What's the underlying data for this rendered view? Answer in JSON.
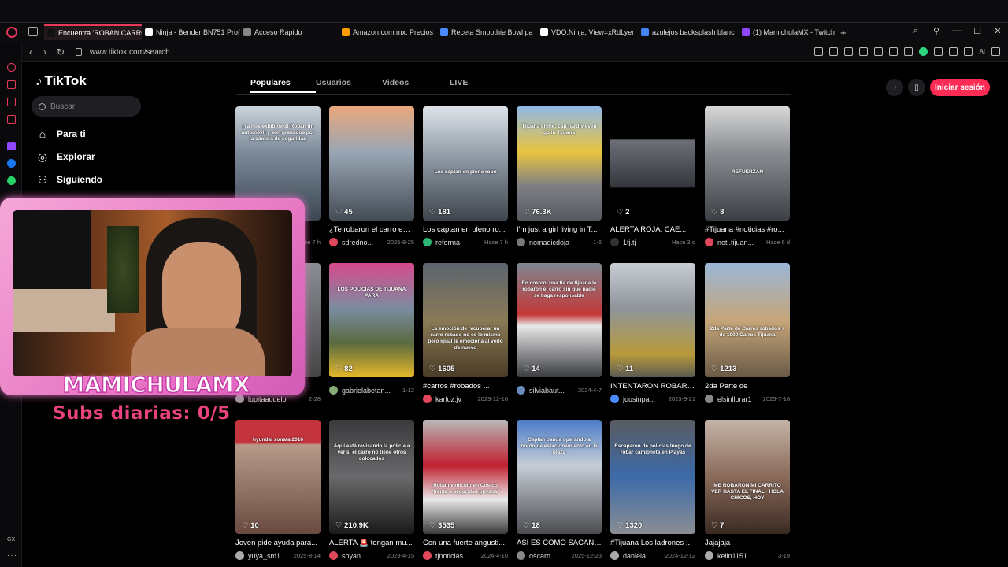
{
  "browser": {
    "tabs": [
      {
        "label": "Encuentra 'ROBAN CARRO",
        "color": "#111",
        "active": true
      },
      {
        "label": "Ninja - Bender BN751 Profe",
        "color": "#ffffff"
      },
      {
        "label": "Acceso Rápido",
        "color": "#888888"
      },
      {
        "label": "Amazon.com.mx: Precios",
        "color": "#ff9900"
      },
      {
        "label": "Receta Smoothie Bowl pa",
        "color": "#4a8cff"
      },
      {
        "label": "VDO.Ninja, View=xRdLyer",
        "color": "#ffffff"
      },
      {
        "label": "azulejos backsplash blanc",
        "color": "#4285f4"
      },
      {
        "label": "(1) MamichulaMX - Twitch",
        "color": "#9146ff"
      }
    ],
    "new_tab": "+",
    "url": "www.tiktok.com/search",
    "ai_label": "AI",
    "gx_label": "GX",
    "more_label": "···"
  },
  "tiktok": {
    "logo": "TikTok",
    "search_placeholder": "Buscar",
    "nav": [
      {
        "label": "Para ti",
        "icon": "home-icon"
      },
      {
        "label": "Explorar",
        "icon": "compass-icon"
      },
      {
        "label": "Siguiendo",
        "icon": "following-icon"
      }
    ],
    "tabs": [
      "Populares",
      "Usuarios",
      "Videos",
      "LIVE"
    ],
    "login": "Iniciar sesión",
    "videos": [
      {
        "likes": "",
        "caption": "...en",
        "user": "",
        "date": "Hace 7 h",
        "bg": "linear-gradient(#c9d3dc,#7d8a98 40%,#3a4652)",
        "av": "#888",
        "ovtxt": "¡Ya nos exhibimos! Roban un automóvil y son grabados por la cámara de seguridad"
      },
      {
        "likes": "45",
        "caption": "¿Te robaron el carro en ...",
        "user": "sdredno...",
        "date": "2025-8-25",
        "bg": "linear-gradient(#e8a77a,#9aa6b4 40%,#444c55)",
        "av": "#e0475b",
        "ovtxt": ""
      },
      {
        "likes": "181",
        "caption": "Los captan en pleno ro...",
        "user": "reforma",
        "date": "Hace 7 h",
        "bg": "linear-gradient(#dde3e8,#8f9aa5 45%,#3e454c)",
        "av": "#2bb673",
        "ovtxt": "Los captan en pleno robo"
      },
      {
        "likes": "76.3K",
        "caption": "I'm just a girl living in T...",
        "user": "nomadicdoja",
        "date": "1-6",
        "bg": "linear-gradient(#8fb8e8,#e9c43e 40%,#7d7f84 70%,#565a60)",
        "av": "#777",
        "ovtxt": "Tijuana crime: can hardly even go in Tijuana"
      },
      {
        "likes": "2",
        "caption": "ALERTA ROJA: CAE...",
        "user": "1tj.tj",
        "date": "Hace 3 d",
        "bg": "linear-gradient(#000 0%,#000 28%,#6c6f76 30%,#34373c 70%,#000 72%)",
        "av": "#333",
        "ovtxt": ""
      },
      {
        "likes": "8",
        "caption": "#Tijuana #noticias #ro...",
        "user": "noti.tijuan...",
        "date": "Hace 6 d",
        "bg": "linear-gradient(#d8d8d8,#8a8d92 40%,#3c3f44)",
        "av": "#e0475b",
        "ovtxt": "REFUERZAN"
      },
      {
        "likes": "",
        "caption": "...y si...",
        "user": "lupitaaudelo",
        "date": "2-28",
        "bg": "linear-gradient(#8a8e94,#444)",
        "av": "#999",
        "ovtxt": ""
      },
      {
        "likes": "82",
        "caption": "",
        "user": "gabrielabetan...",
        "date": "1-12",
        "bg": "linear-gradient(#d64a8c,#7a8ca0 40%,#5a6a40 70%,#e6b82a)",
        "av": "#8a7",
        "ovtxt": "LOS POLICIAS DE TIJUANA PARA"
      },
      {
        "likes": "1605",
        "caption": "#carros #robados ...",
        "user": "karloz.jv",
        "date": "2023-12-16",
        "bg": "linear-gradient(#5c6470,#8a7a56 50%,#4a3c26)",
        "av": "#e0475b",
        "ovtxt": "La emoción de recuperar un carro robado no es lo mismo pero igual te emociona al verlo de nuevo"
      },
      {
        "likes": "14",
        "caption": "",
        "user": "silviabaut...",
        "date": "2024-4-7",
        "bg": "linear-gradient(#7e8690,#c43838 45%,#e8e8e8 55%,#3a3c40)",
        "av": "#6a8cbb",
        "ovtxt": "En costco, una tía de tijuana le robaron el carro sin que nadie se haga responsable"
      },
      {
        "likes": "11",
        "caption": "INTENTARON ROBAR ...",
        "user": "jousinpa...",
        "date": "2023-9-21",
        "bg": "linear-gradient(#c8cdd2,#8e949a 40%,#b89a3a 80%,#5a5a52)",
        "av": "#4a8cff",
        "ovtxt": ""
      },
      {
        "likes": "1213",
        "caption": "2da Parte de",
        "user": "elsinllorar1",
        "date": "2025-7-16",
        "bg": "linear-gradient(#9ab6d6,#c6a67a 50%,#6a5a46)",
        "av": "#888",
        "ovtxt": "2da Parte de Carros robados + de 1000 Carros Tijuana"
      },
      {
        "likes": "10",
        "caption": "Joven pide ayuda para...",
        "user": "yuya_sm1",
        "date": "2025-8-14",
        "bg": "linear-gradient(#c4343c 0%,#c4343c 20%,#b89a8a 22%,#6a4a40)",
        "av": "#aaa",
        "ovtxt": "hyundai sonata 2016"
      },
      {
        "likes": "210.9K",
        "caption": "ALERTA 🚨 tengan mu...",
        "user": "soyan...",
        "date": "2023-4-15",
        "bg": "linear-gradient(#3a3a3c,#6a6a6c 50%,#1a1a1a)",
        "av": "#e0475b",
        "ovtxt": "Aquí está revisando la policía a ver si el carro no tiene otros colocados"
      },
      {
        "likes": "3535",
        "caption": "Con una fuerte angusti...",
        "user": "tjnoticias",
        "date": "2024-4-10",
        "bg": "linear-gradient(#b8b8b8,#c02030 40%,#e8e8e8 70%,#3a3a3a)",
        "av": "#e0475b",
        "ovtxt": "Roban vehículo en Costco \"frente a seguridad privada\""
      },
      {
        "likes": "18",
        "caption": "ASÍ ES COMO SACAN ...",
        "user": "oscarn...",
        "date": "2025-12-23",
        "bg": "linear-gradient(#4a7cc8,#c6cdd6 40%,#8a8e94 70%,#4a4c50)",
        "av": "#888",
        "ovtxt": "Captan banda operando a bordo de estacionamiento en la plaza"
      },
      {
        "likes": "1320",
        "caption": "#Tijuana Los ladrones ...",
        "user": "daniela...",
        "date": "2024-12-12",
        "bg": "linear-gradient(#5a5c62,#3c6aa8 50%,#8a8e94)",
        "av": "#aaa",
        "ovtxt": "Escaparon de policías luego de robar camioneta en Playas"
      },
      {
        "likes": "7",
        "caption": "Jajajaja",
        "user": "kelin1151",
        "date": "3-19",
        "bg": "linear-gradient(#c4b4a8,#8a6a5a 50%,#3a2a22)",
        "av": "#aaa",
        "ovtxt": "ME ROBARON MI CARRITO VER HASTA EL FINAL · HOLA CHICOS, HOY"
      }
    ]
  },
  "overlay": {
    "streamer": "MAMICHULAMX",
    "subs_text": "Subs diarias: 0/5"
  }
}
